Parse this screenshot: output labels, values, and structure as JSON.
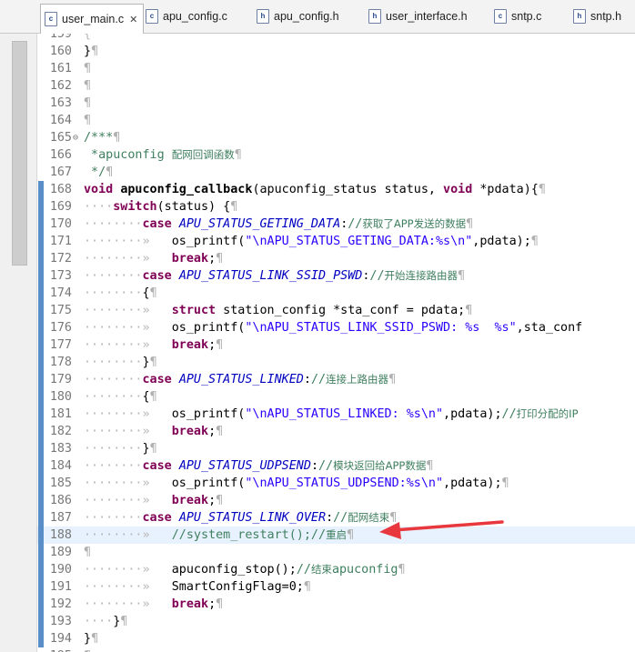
{
  "tabs": [
    {
      "label": "user_main.c",
      "type": "c",
      "active": true
    },
    {
      "label": "apu_config.c",
      "type": "c",
      "active": false
    },
    {
      "label": "apu_config.h",
      "type": "h",
      "active": false
    },
    {
      "label": "user_interface.h",
      "type": "h",
      "active": false
    },
    {
      "label": "sntp.c",
      "type": "c",
      "active": false
    },
    {
      "label": "sntp.h",
      "type": "h",
      "active": false
    }
  ],
  "editor": {
    "current_line": "188",
    "lines": [
      {
        "n": "159",
        "t": [
          {
            "c": "ws",
            "v": "{"
          }
        ]
      },
      {
        "n": "160",
        "t": [
          {
            "v": "}"
          },
          {
            "c": "pil",
            "v": "¶"
          }
        ]
      },
      {
        "n": "161",
        "t": [
          {
            "c": "pil",
            "v": "¶"
          }
        ]
      },
      {
        "n": "162",
        "t": [
          {
            "c": "pil",
            "v": "¶"
          }
        ]
      },
      {
        "n": "163",
        "t": [
          {
            "c": "pil",
            "v": "¶"
          }
        ]
      },
      {
        "n": "164",
        "t": [
          {
            "c": "pil",
            "v": "¶"
          }
        ]
      },
      {
        "n": "165",
        "fold": true,
        "t": [
          {
            "c": "cmt",
            "v": "/***"
          },
          {
            "c": "pil",
            "v": "¶"
          }
        ]
      },
      {
        "n": "166",
        "t": [
          {
            "c": "cmt",
            "v": " *apuconfig "
          },
          {
            "c": "cmt cjk",
            "v": "配网回调函数"
          },
          {
            "c": "pil",
            "v": "¶"
          }
        ]
      },
      {
        "n": "167",
        "t": [
          {
            "c": "cmt",
            "v": " */"
          },
          {
            "c": "pil",
            "v": "¶"
          }
        ]
      },
      {
        "n": "168",
        "marker": true,
        "t": [
          {
            "c": "kw",
            "v": "void"
          },
          {
            "v": " "
          },
          {
            "v": "apuconfig_callback",
            "bold": true
          },
          {
            "v": "(apuconfig_status status, "
          },
          {
            "c": "kw",
            "v": "void"
          },
          {
            "v": " *pdata){"
          },
          {
            "c": "pil",
            "v": "¶"
          }
        ]
      },
      {
        "n": "169",
        "marker": true,
        "t": [
          {
            "c": "ws",
            "v": "····"
          },
          {
            "c": "kw",
            "v": "switch"
          },
          {
            "v": "(status) {"
          },
          {
            "c": "pil",
            "v": "¶"
          }
        ]
      },
      {
        "n": "170",
        "marker": true,
        "t": [
          {
            "c": "ws",
            "v": "········"
          },
          {
            "c": "kw",
            "v": "case"
          },
          {
            "v": " "
          },
          {
            "c": "cst",
            "v": "APU_STATUS_GETING_DATA"
          },
          {
            "v": ":"
          },
          {
            "c": "cmt",
            "v": "//"
          },
          {
            "c": "cmt cjk",
            "v": "获取了APP发送的数据"
          },
          {
            "c": "pil",
            "v": "¶"
          }
        ]
      },
      {
        "n": "171",
        "marker": true,
        "t": [
          {
            "c": "ws",
            "v": "········»   "
          },
          {
            "v": "os_printf("
          },
          {
            "c": "str",
            "v": "\"\\nAPU_STATUS_GETING_DATA:%s\\n\""
          },
          {
            "v": ",pdata);"
          },
          {
            "c": "pil",
            "v": "¶"
          }
        ]
      },
      {
        "n": "172",
        "marker": true,
        "t": [
          {
            "c": "ws",
            "v": "········»   "
          },
          {
            "c": "kw",
            "v": "break"
          },
          {
            "v": ";"
          },
          {
            "c": "pil",
            "v": "¶"
          }
        ]
      },
      {
        "n": "173",
        "marker": true,
        "t": [
          {
            "c": "ws",
            "v": "········"
          },
          {
            "c": "kw",
            "v": "case"
          },
          {
            "v": " "
          },
          {
            "c": "cst",
            "v": "APU_STATUS_LINK_SSID_PSWD"
          },
          {
            "v": ":"
          },
          {
            "c": "cmt",
            "v": "//"
          },
          {
            "c": "cmt cjk",
            "v": "开始连接路由器"
          },
          {
            "c": "pil",
            "v": "¶"
          }
        ]
      },
      {
        "n": "174",
        "marker": true,
        "t": [
          {
            "c": "ws",
            "v": "········"
          },
          {
            "v": "{"
          },
          {
            "c": "pil",
            "v": "¶"
          }
        ]
      },
      {
        "n": "175",
        "marker": true,
        "t": [
          {
            "c": "ws",
            "v": "········»   "
          },
          {
            "c": "kw",
            "v": "struct"
          },
          {
            "v": " station_config *sta_conf = pdata;"
          },
          {
            "c": "pil",
            "v": "¶"
          }
        ]
      },
      {
        "n": "176",
        "marker": true,
        "t": [
          {
            "c": "ws",
            "v": "········»   "
          },
          {
            "v": "os_printf("
          },
          {
            "c": "str",
            "v": "\"\\nAPU_STATUS_LINK_SSID_PSWD: %s  %s\""
          },
          {
            "v": ",sta_conf"
          }
        ]
      },
      {
        "n": "177",
        "marker": true,
        "t": [
          {
            "c": "ws",
            "v": "········»   "
          },
          {
            "c": "kw",
            "v": "break"
          },
          {
            "v": ";"
          },
          {
            "c": "pil",
            "v": "¶"
          }
        ]
      },
      {
        "n": "178",
        "marker": true,
        "t": [
          {
            "c": "ws",
            "v": "········"
          },
          {
            "v": "}"
          },
          {
            "c": "pil",
            "v": "¶"
          }
        ]
      },
      {
        "n": "179",
        "marker": true,
        "t": [
          {
            "c": "ws",
            "v": "········"
          },
          {
            "c": "kw",
            "v": "case"
          },
          {
            "v": " "
          },
          {
            "c": "cst",
            "v": "APU_STATUS_LINKED"
          },
          {
            "v": ":"
          },
          {
            "c": "cmt",
            "v": "//"
          },
          {
            "c": "cmt cjk",
            "v": "连接上路由器"
          },
          {
            "c": "pil",
            "v": "¶"
          }
        ]
      },
      {
        "n": "180",
        "marker": true,
        "t": [
          {
            "c": "ws",
            "v": "········"
          },
          {
            "v": "{"
          },
          {
            "c": "pil",
            "v": "¶"
          }
        ]
      },
      {
        "n": "181",
        "marker": true,
        "t": [
          {
            "c": "ws",
            "v": "········»   "
          },
          {
            "v": "os_printf("
          },
          {
            "c": "str",
            "v": "\"\\nAPU_STATUS_LINKED: %s\\n\""
          },
          {
            "v": ",pdata);"
          },
          {
            "c": "cmt",
            "v": "//"
          },
          {
            "c": "cmt cjk",
            "v": "打印分配的IP"
          }
        ]
      },
      {
        "n": "182",
        "marker": true,
        "t": [
          {
            "c": "ws",
            "v": "········»   "
          },
          {
            "c": "kw",
            "v": "break"
          },
          {
            "v": ";"
          },
          {
            "c": "pil",
            "v": "¶"
          }
        ]
      },
      {
        "n": "183",
        "marker": true,
        "t": [
          {
            "c": "ws",
            "v": "········"
          },
          {
            "v": "}"
          },
          {
            "c": "pil",
            "v": "¶"
          }
        ]
      },
      {
        "n": "184",
        "marker": true,
        "t": [
          {
            "c": "ws",
            "v": "········"
          },
          {
            "c": "kw",
            "v": "case"
          },
          {
            "v": " "
          },
          {
            "c": "cst",
            "v": "APU_STATUS_UDPSEND"
          },
          {
            "v": ":"
          },
          {
            "c": "cmt",
            "v": "//"
          },
          {
            "c": "cmt cjk",
            "v": "模块返回给APP数据"
          },
          {
            "c": "pil",
            "v": "¶"
          }
        ]
      },
      {
        "n": "185",
        "marker": true,
        "t": [
          {
            "c": "ws",
            "v": "········»   "
          },
          {
            "v": "os_printf("
          },
          {
            "c": "str",
            "v": "\"\\nAPU_STATUS_UDPSEND:%s\\n\""
          },
          {
            "v": ",pdata);"
          },
          {
            "c": "pil",
            "v": "¶"
          }
        ]
      },
      {
        "n": "186",
        "marker": true,
        "t": [
          {
            "c": "ws",
            "v": "········»   "
          },
          {
            "c": "kw",
            "v": "break"
          },
          {
            "v": ";"
          },
          {
            "c": "pil",
            "v": "¶"
          }
        ]
      },
      {
        "n": "187",
        "marker": true,
        "t": [
          {
            "c": "ws",
            "v": "········"
          },
          {
            "c": "kw",
            "v": "case"
          },
          {
            "v": " "
          },
          {
            "c": "cst",
            "v": "APU_STATUS_LINK_OVER"
          },
          {
            "v": ":"
          },
          {
            "c": "cmt",
            "v": "//"
          },
          {
            "c": "cmt cjk",
            "v": "配网结束"
          },
          {
            "c": "pil",
            "v": "¶"
          }
        ]
      },
      {
        "n": "188",
        "marker": true,
        "hl": true,
        "t": [
          {
            "c": "ws",
            "v": "········»   "
          },
          {
            "c": "cmt",
            "v": "//system_restart();//"
          },
          {
            "c": "cmt cjk",
            "v": "重启"
          },
          {
            "c": "pil",
            "v": "¶"
          }
        ]
      },
      {
        "n": "189",
        "marker": true,
        "t": [
          {
            "c": "pil",
            "v": "¶"
          }
        ]
      },
      {
        "n": "190",
        "marker": true,
        "t": [
          {
            "c": "ws",
            "v": "········»   "
          },
          {
            "v": "apuconfig_stop();"
          },
          {
            "c": "cmt",
            "v": "//"
          },
          {
            "c": "cmt cjk",
            "v": "结束"
          },
          {
            "c": "cmt",
            "v": "apuconfig"
          },
          {
            "c": "pil",
            "v": "¶"
          }
        ]
      },
      {
        "n": "191",
        "marker": true,
        "t": [
          {
            "c": "ws",
            "v": "········»   "
          },
          {
            "v": "SmartConfigFlag=0;"
          },
          {
            "c": "pil",
            "v": "¶"
          }
        ]
      },
      {
        "n": "192",
        "marker": true,
        "t": [
          {
            "c": "ws",
            "v": "········»   "
          },
          {
            "c": "kw",
            "v": "break"
          },
          {
            "v": ";"
          },
          {
            "c": "pil",
            "v": "¶"
          }
        ]
      },
      {
        "n": "193",
        "marker": true,
        "t": [
          {
            "c": "ws",
            "v": "····"
          },
          {
            "v": "}"
          },
          {
            "c": "pil",
            "v": "¶"
          }
        ]
      },
      {
        "n": "194",
        "marker": true,
        "t": [
          {
            "v": "}"
          },
          {
            "c": "pil",
            "v": "¶"
          }
        ]
      },
      {
        "n": "195",
        "t": [
          {
            "c": "pil",
            "v": "¶"
          }
        ]
      }
    ]
  },
  "colors": {
    "keyword": "#7f0055",
    "constant": "#0000c0",
    "string": "#2a00ff",
    "comment": "#3f7f5f",
    "arrow": "#e8383d",
    "current_line_bg": "#e8f2fe"
  }
}
